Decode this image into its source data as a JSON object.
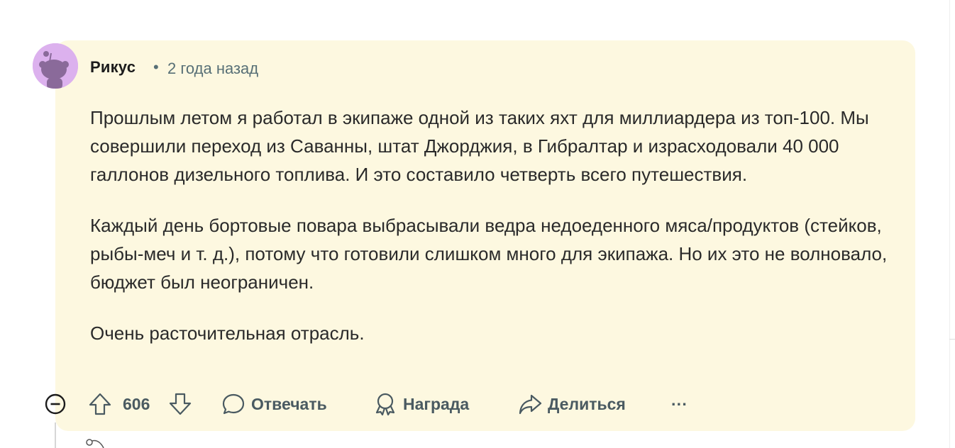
{
  "comment": {
    "author": "Рикус",
    "separator": "•",
    "timestamp": "2 года назад",
    "paragraphs": [
      "Прошлым летом я работал в экипаже одной из таких яхт для миллиардера из топ-100. Мы совершили переход из Саванны, штат Джорджия, в Гибралтар и израсходовали 40 000 галлонов дизельного топлива. И это составило четверть всего путешествия.",
      "Каждый день бортовые повара выбрасывали ведра недоеденного мяса/продуктов (стейков, рыбы-меч и т. д.), потому что готовили слишком много для экипажа. Но их это не волновало, бюджет был неограничен.",
      "Очень расточительная отрасль."
    ]
  },
  "actions": {
    "score": "606",
    "reply_label": "Отвечать",
    "award_label": "Награда",
    "share_label": "Делиться",
    "more_label": "···"
  },
  "colors": {
    "card_background": "#fdf8e0",
    "avatar_background": "#dcb1ee",
    "meta_text": "#576f76",
    "action_text": "#4a5a61"
  },
  "icons": {
    "collapse": "minus-circle-icon",
    "upvote": "arrow-up-icon",
    "downvote": "arrow-down-icon",
    "reply": "speech-bubble-icon",
    "award": "award-ribbon-icon",
    "share": "share-arrow-icon",
    "more": "ellipsis-icon",
    "avatar": "snoo-avatar-icon"
  }
}
